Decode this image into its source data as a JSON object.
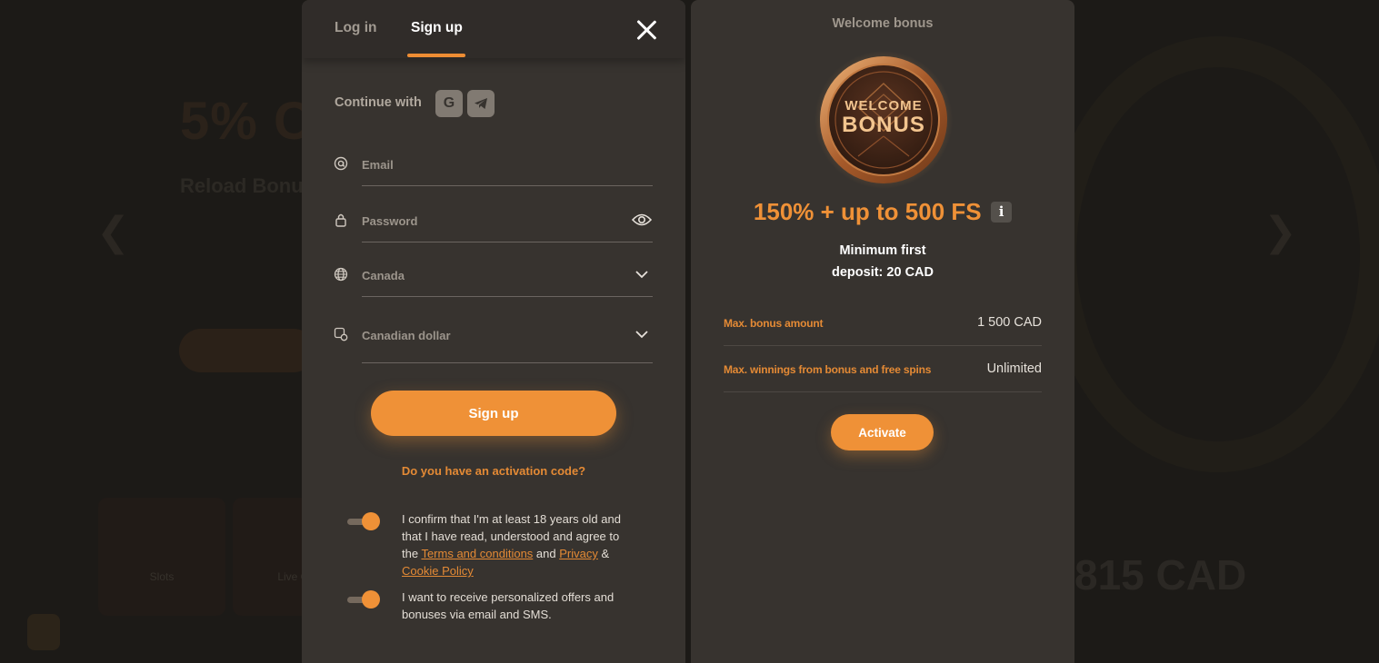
{
  "background": {
    "promo_title": "5% C",
    "promo_subtitle": "Reload Bonu",
    "pill_label": "",
    "cards": [
      "Slots",
      "Live Ga"
    ],
    "amount": "815 CAD"
  },
  "auth": {
    "tabs": {
      "login": "Log in",
      "signup": "Sign up",
      "active": "signup"
    },
    "continue_with": "Continue with",
    "social": [
      "google-icon",
      "telegram-icon"
    ],
    "fields": {
      "email": {
        "placeholder": "Email",
        "icon": "at-icon"
      },
      "password": {
        "placeholder": "Password",
        "icon": "lock-icon"
      },
      "country": {
        "value": "Canada",
        "icon": "globe-icon"
      },
      "currency": {
        "value": "Canadian dollar",
        "icon": "currency-icon"
      }
    },
    "signup_button": "Sign up",
    "activation_link": "Do you have an activation code?",
    "consents": {
      "age": {
        "text_1": "I confirm that I'm at least 18 years old and that I have read, understood and agree to the ",
        "terms_link": "Terms and conditions",
        "and": " and ",
        "privacy_link": "Privacy",
        "amp": " & ",
        "cookie_link": "Cookie Policy",
        "checked": true
      },
      "offers": {
        "text": "I want to receive personalized offers and bonuses via email and SMS.",
        "checked": true
      }
    }
  },
  "bonus": {
    "heading": "Welcome bonus",
    "coin_text_1": "WELCOME",
    "coin_text_2": "BONUS",
    "offer": "150% + up to 500 FS",
    "info_label": "i",
    "min_deposit_1": "Minimum first",
    "min_deposit_2": "deposit: 20 CAD",
    "rows": [
      {
        "label": "Max. bonus amount",
        "value": "1 500 CAD"
      },
      {
        "label": "Max. winnings from bonus and free spins",
        "value": "Unlimited"
      }
    ],
    "activate_button": "Activate"
  },
  "colors": {
    "accent": "#ef9137",
    "panel": "#37332f",
    "background": "#221f1c"
  }
}
